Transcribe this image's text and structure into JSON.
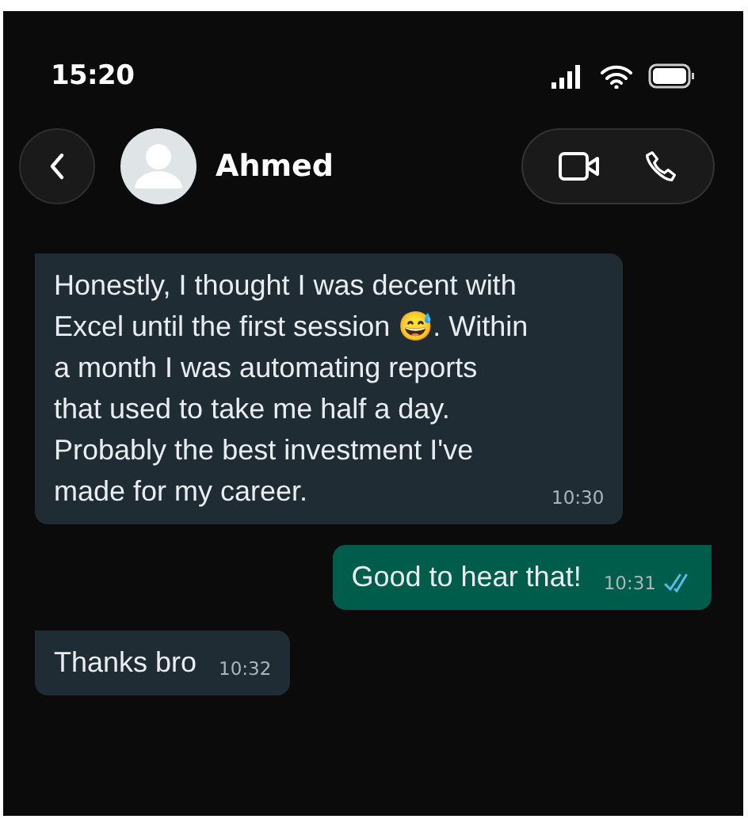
{
  "status_bar": {
    "time": "15:20"
  },
  "header": {
    "contact_name": "Ahmed"
  },
  "messages": [
    {
      "kind": "incoming",
      "text": "Honestly, I thought I was decent with Excel until the first session 😅. Within a month I was automating reports that used to take me half a day. Probably the best investment I've made for my career.",
      "time": "10:30"
    },
    {
      "kind": "outgoing",
      "text": "Good to hear that!",
      "time": "10:31",
      "read": true
    },
    {
      "kind": "incoming",
      "text": "Thanks bro",
      "time": "10:32"
    }
  ]
}
